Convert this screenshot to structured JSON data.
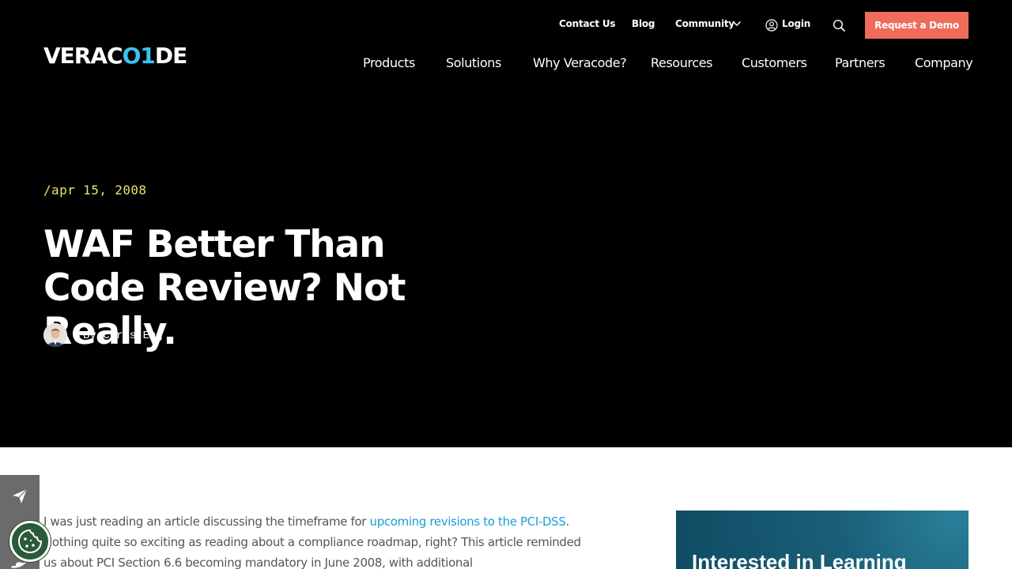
{
  "brand": {
    "logo_text_a": "VERAC",
    "logo_text_b": "O1",
    "logo_text_c": "DE",
    "accent": "#3ec1ed"
  },
  "topbar": {
    "contact": "Contact Us",
    "blog": "Blog",
    "community": "Community",
    "login": "Login",
    "demo": "Request a Demo",
    "demo_color": "#ef6b5a"
  },
  "nav": {
    "items": [
      "Products",
      "Solutions",
      "Why Veracode?",
      "Resources",
      "Customers",
      "Partners",
      "Company"
    ]
  },
  "hero": {
    "date": "/apr 15, 2008",
    "title": "WAF Better Than Code Review? Not Really.",
    "byline": "By Chris Eng",
    "date_color": "#e8e36a"
  },
  "article": {
    "p1_a": "I was just reading an article discussing the timeframe for ",
    "p1_link": "upcoming revisions to the PCI-DSS",
    "p1_b": ". Nothing quite so exciting as reading about a compliance roadmap, right? This article reminded us about PCI Section 6.6 becoming mandatory in June 2008, with additional",
    "link_color": "#1a9fd6"
  },
  "sidebar": {
    "card_title": "Interested in Learning"
  },
  "icons": {
    "share": "paper-plane-icon",
    "cookie": "cookie-icon",
    "search": "search-icon",
    "login": "user-circle-icon",
    "chevron": "chevron-down-icon"
  }
}
